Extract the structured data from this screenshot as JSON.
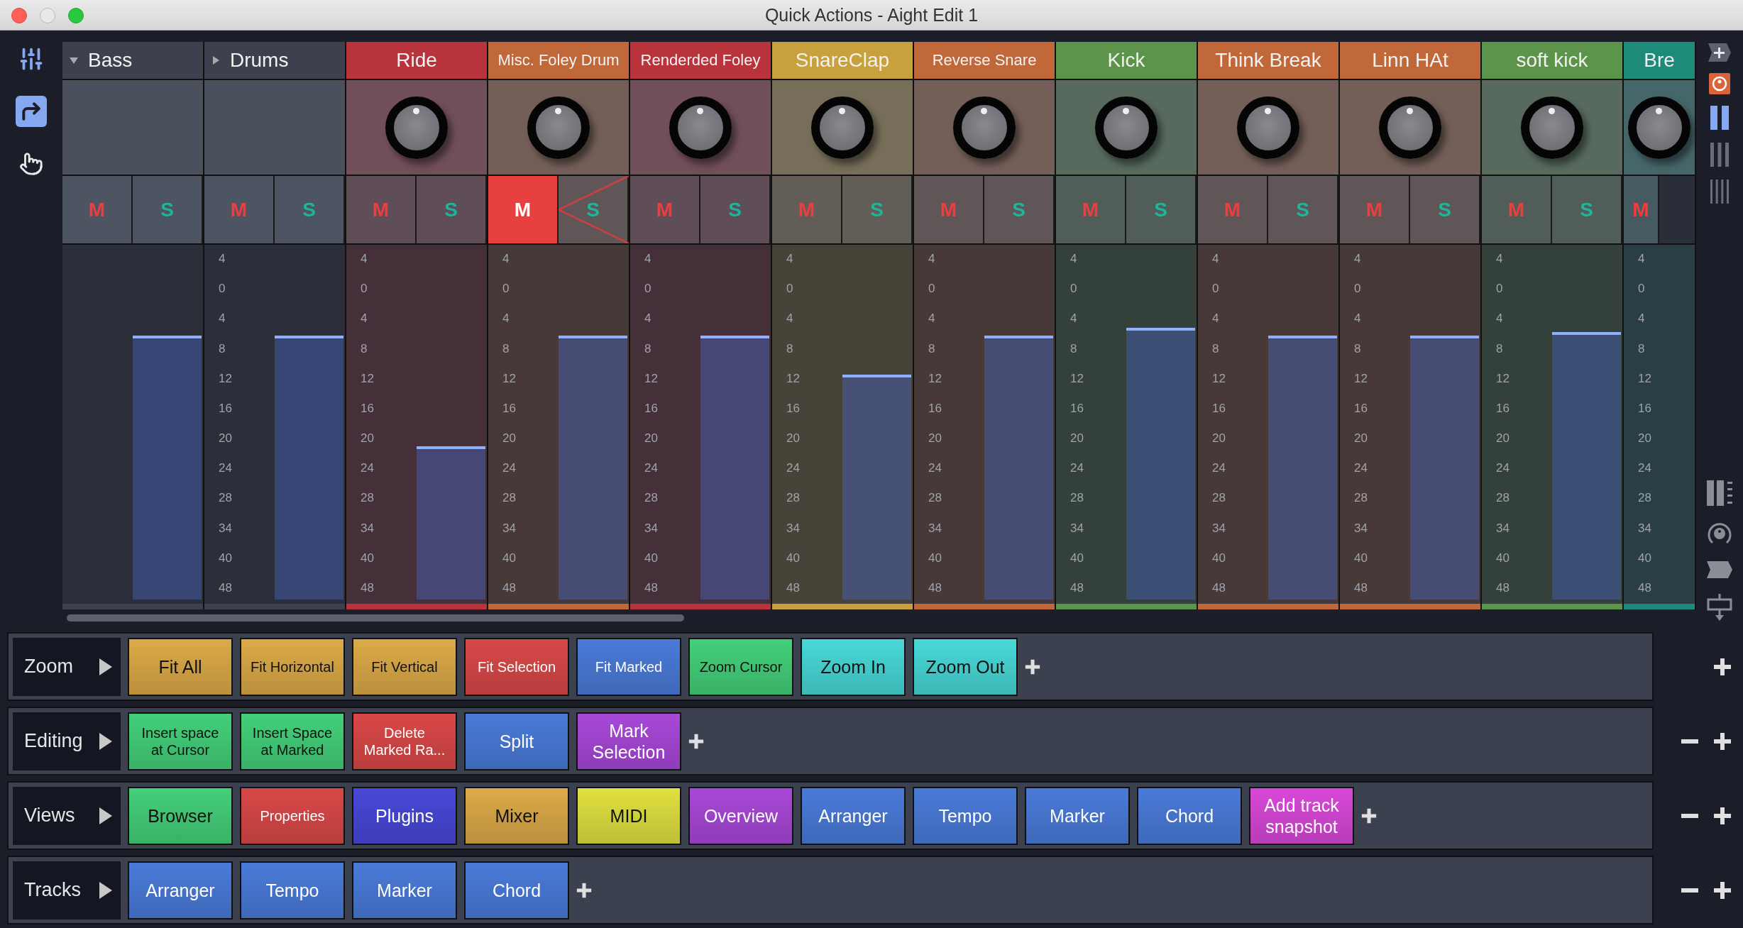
{
  "window": {
    "title": "Quick Actions - Aight Edit 1"
  },
  "tools": [
    {
      "kind": "mixer",
      "selected": false
    },
    {
      "kind": "redo",
      "selected": true
    },
    {
      "kind": "hand",
      "selected": false
    }
  ],
  "channels": [
    {
      "name": "Bass",
      "kind": "folder",
      "expanded": true,
      "mute_label": "M",
      "solo_label": "S",
      "muted": false,
      "solo_blocked": false,
      "level": 0.74
    },
    {
      "name": "Drums",
      "kind": "folder",
      "expanded": false,
      "mute_label": "M",
      "solo_label": "S",
      "muted": false,
      "solo_blocked": false,
      "level": 0.74,
      "scale": [
        "4",
        "0",
        "4",
        "8",
        "12",
        "16",
        "20",
        "24",
        "28",
        "34",
        "40",
        "48"
      ]
    },
    {
      "name": "Ride",
      "kind": "track",
      "color": "#b8333b",
      "mute_label": "M",
      "solo_label": "S",
      "muted": false,
      "solo_blocked": false,
      "level": 0.43,
      "scale": [
        "4",
        "0",
        "4",
        "8",
        "12",
        "16",
        "20",
        "24",
        "28",
        "34",
        "40",
        "48"
      ]
    },
    {
      "name": "Misc. Foley Drum",
      "kind": "track",
      "color": "#c0683a",
      "mute_label": "M",
      "solo_label": "S",
      "muted": true,
      "solo_blocked": true,
      "level": 0.74,
      "scale": [
        "4",
        "0",
        "4",
        "8",
        "12",
        "16",
        "20",
        "24",
        "28",
        "34",
        "40",
        "48"
      ]
    },
    {
      "name": "Renderded Foley",
      "kind": "track",
      "color": "#b8333b",
      "mute_label": "M",
      "solo_label": "S",
      "muted": false,
      "solo_blocked": false,
      "level": 0.74,
      "scale": [
        "4",
        "0",
        "4",
        "8",
        "12",
        "16",
        "20",
        "24",
        "28",
        "34",
        "40",
        "48"
      ]
    },
    {
      "name": "SnareClap",
      "kind": "track",
      "color": "#c9a03e",
      "mute_label": "M",
      "solo_label": "S",
      "muted": false,
      "solo_blocked": false,
      "level": 0.63,
      "scale": [
        "4",
        "0",
        "4",
        "8",
        "12",
        "16",
        "20",
        "24",
        "28",
        "34",
        "40",
        "48"
      ]
    },
    {
      "name": "Reverse Snare",
      "kind": "track",
      "color": "#c0683a",
      "mute_label": "M",
      "solo_label": "S",
      "muted": false,
      "solo_blocked": false,
      "level": 0.74,
      "scale": [
        "4",
        "0",
        "4",
        "8",
        "12",
        "16",
        "20",
        "24",
        "28",
        "34",
        "40",
        "48"
      ]
    },
    {
      "name": "Kick",
      "kind": "track",
      "color": "#5b944a",
      "mute_label": "M",
      "solo_label": "S",
      "muted": false,
      "solo_blocked": false,
      "level": 0.76,
      "scale": [
        "4",
        "0",
        "4",
        "8",
        "12",
        "16",
        "20",
        "24",
        "28",
        "34",
        "40",
        "48"
      ]
    },
    {
      "name": "Think Break",
      "kind": "track",
      "color": "#c0683a",
      "mute_label": "M",
      "solo_label": "S",
      "muted": false,
      "solo_blocked": false,
      "level": 0.74,
      "scale": [
        "4",
        "0",
        "4",
        "8",
        "12",
        "16",
        "20",
        "24",
        "28",
        "34",
        "40",
        "48"
      ]
    },
    {
      "name": "Linn HAt",
      "kind": "track",
      "color": "#c0683a",
      "mute_label": "M",
      "solo_label": "S",
      "muted": false,
      "solo_blocked": false,
      "level": 0.74,
      "scale": [
        "4",
        "0",
        "4",
        "8",
        "12",
        "16",
        "20",
        "24",
        "28",
        "34",
        "40",
        "48"
      ]
    },
    {
      "name": "soft kick",
      "kind": "track",
      "color": "#5b944a",
      "mute_label": "M",
      "solo_label": "S",
      "muted": false,
      "solo_blocked": false,
      "level": 0.75,
      "scale": [
        "4",
        "0",
        "4",
        "8",
        "12",
        "16",
        "20",
        "24",
        "28",
        "34",
        "40",
        "48"
      ]
    },
    {
      "name": "Bre",
      "kind": "track",
      "color": "#1e8a7a",
      "mute_label": "M",
      "muted": false,
      "scale": [
        "4",
        "0",
        "4",
        "8",
        "12",
        "16",
        "20",
        "24",
        "28",
        "34",
        "40",
        "48"
      ]
    }
  ],
  "side_tools": [
    {
      "kind": "add"
    },
    {
      "kind": "knob",
      "selected": true
    },
    {
      "kind": "bars2",
      "selected": true
    },
    {
      "kind": "bars3",
      "selected": false
    },
    {
      "kind": "bars4",
      "selected": false
    }
  ],
  "side_tools_bottom": [
    {
      "kind": "meters"
    },
    {
      "kind": "knob-outline"
    },
    {
      "kind": "marker"
    },
    {
      "kind": "insert"
    }
  ],
  "quick_actions": [
    {
      "label": "Zoom",
      "removable": false,
      "actions": [
        {
          "label": "Fit All",
          "color": "#dcaa48"
        },
        {
          "label": "Fit Horizontal",
          "color": "#dcaa48"
        },
        {
          "label": "Fit Vertical",
          "color": "#dcaa48"
        },
        {
          "label": "Fit Selection",
          "color": "#d94848"
        },
        {
          "label": "Fit Marked",
          "color": "#4a7bd9"
        },
        {
          "label": "Zoom Cursor",
          "color": "#44d07a"
        },
        {
          "label": "Zoom In",
          "color": "#48d8d8"
        },
        {
          "label": "Zoom Out",
          "color": "#48d8d8"
        }
      ]
    },
    {
      "label": "Editing",
      "removable": true,
      "actions": [
        {
          "label": "Insert space\nat Cursor",
          "color": "#44d07a"
        },
        {
          "label": "Insert Space\nat Marked",
          "color": "#44d07a"
        },
        {
          "label": "Delete\nMarked Ra...",
          "color": "#d94848"
        },
        {
          "label": "Split",
          "color": "#4a7bd9"
        },
        {
          "label": "Mark\nSelection",
          "color": "#a848d8"
        }
      ]
    },
    {
      "label": "Views",
      "removable": true,
      "actions": [
        {
          "label": "Browser",
          "color": "#44d07a"
        },
        {
          "label": "Properties",
          "color": "#d94848"
        },
        {
          "label": "Plugins",
          "color": "#4848d8"
        },
        {
          "label": "Mixer",
          "color": "#dcaa48"
        },
        {
          "label": "MIDI",
          "color": "#e0e040"
        },
        {
          "label": "Overview",
          "color": "#a848d8"
        },
        {
          "label": "Arranger",
          "color": "#4a7bd9"
        },
        {
          "label": "Tempo",
          "color": "#4a7bd9"
        },
        {
          "label": "Marker",
          "color": "#4a7bd9"
        },
        {
          "label": "Chord",
          "color": "#4a7bd9"
        },
        {
          "label": "Add track\nsnapshot",
          "color": "#d848d8"
        }
      ]
    },
    {
      "label": "Tracks",
      "removable": true,
      "actions": [
        {
          "label": "Arranger",
          "color": "#4a7bd9"
        },
        {
          "label": "Tempo",
          "color": "#4a7bd9"
        },
        {
          "label": "Marker",
          "color": "#4a7bd9"
        },
        {
          "label": "Chord",
          "color": "#4a7bd9"
        }
      ]
    }
  ]
}
